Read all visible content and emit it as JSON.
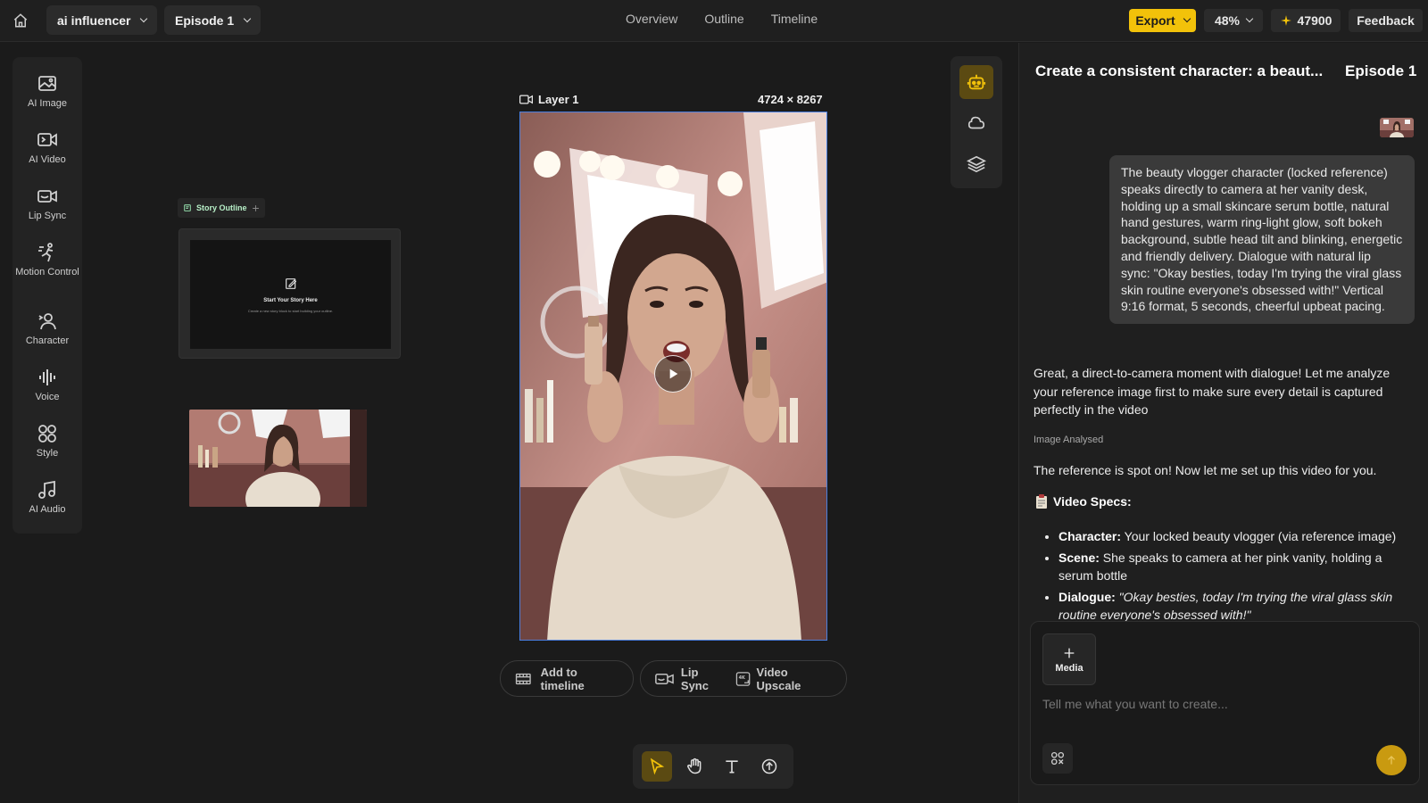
{
  "topbar": {
    "project": "ai influencer",
    "episode": "Episode 1",
    "nav": [
      "Overview",
      "Outline",
      "Timeline"
    ],
    "export_label": "Export",
    "zoom": "48%",
    "credits": "47900",
    "feedback": "Feedback"
  },
  "tools": [
    {
      "label": "AI Image",
      "icon": "image-icon"
    },
    {
      "label": "AI Video",
      "icon": "video-icon"
    },
    {
      "label": "Lip Sync",
      "icon": "lipsync-icon"
    },
    {
      "label": "Motion Control",
      "icon": "motion-icon"
    },
    {
      "label": "Character",
      "icon": "character-icon"
    },
    {
      "label": "Voice",
      "icon": "voice-icon"
    },
    {
      "label": "Style",
      "icon": "style-icon"
    },
    {
      "label": "AI Audio",
      "icon": "audio-icon"
    }
  ],
  "story": {
    "tag": "Story Outline",
    "heading": "Start Your Story Here",
    "sub": "Create a new story block to start building your outline."
  },
  "layer": {
    "name": "Layer 1",
    "size": "4724 × 8267"
  },
  "actions": {
    "add_timeline": "Add to timeline",
    "lip_sync": "Lip Sync",
    "upscale": "Video Upscale"
  },
  "chat": {
    "title": "Create a consistent character: a beaut...",
    "episode": "Episode 1",
    "user_message": "The beauty vlogger character (locked reference) speaks directly to camera at her vanity desk, holding up a small skincare serum bottle, natural hand gestures, warm ring-light glow, soft bokeh background, subtle head tilt and blinking, energetic and friendly delivery. Dialogue with natural lip sync: \"Okay besties, today I'm trying the viral glass skin routine everyone's obsessed with!\" Vertical 9:16 format, 5 seconds, cheerful upbeat pacing.",
    "ai_reply_1": "Great, a direct-to-camera moment with dialogue! Let me analyze your reference image first to make sure every detail is captured perfectly in the video",
    "analysed_tag": "Image Analysed",
    "ai_reply_2": "The reference is spot on! Now let me set up this video for you.",
    "specs_title": "Video Specs:",
    "specs": [
      {
        "key": "Character:",
        "value": " Your locked beauty vlogger (via reference image)"
      },
      {
        "key": "Scene:",
        "value": " She speaks to camera at her pink vanity, holding a serum bottle"
      },
      {
        "key": "Dialogue:",
        "value": " \"Okay besties, today I'm trying the viral glass skin routine everyone's obsessed with!\""
      }
    ],
    "media_label": "Media",
    "input_placeholder": "Tell me what you want to create..."
  },
  "colors": {
    "accent": "#f2c20a",
    "selection": "#4a7fe0",
    "send": "#c99a10"
  }
}
